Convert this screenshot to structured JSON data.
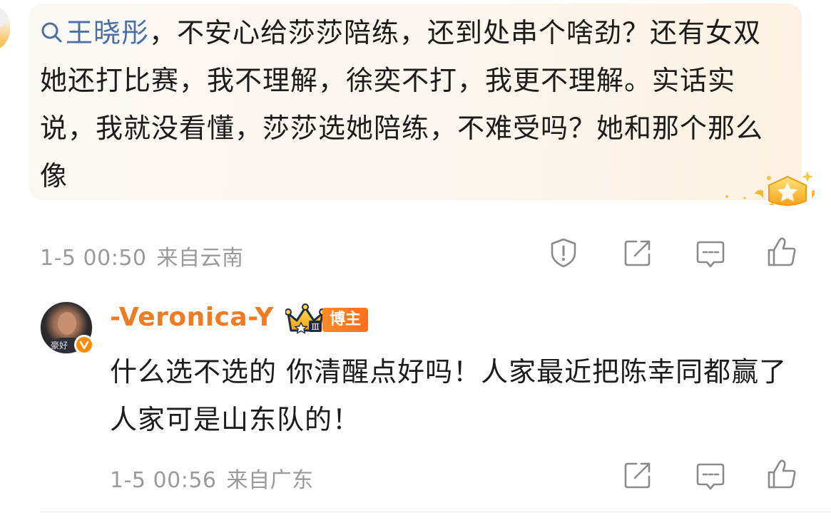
{
  "quoted_comment": {
    "mention": "王晓彤",
    "text": "，不安心给莎莎陪练，还到处串个啥劲？还有女双她还打比赛，我不理解，徐奕不打，我更不理解。实话实说，我就没看懂，莎莎选她陪练，不难受吗？她和那个那么像",
    "time": "1-5 00:50",
    "location": "来自云南"
  },
  "reply": {
    "username": "-Veronica-Y",
    "tag": "博主",
    "crown_level": "Ⅲ",
    "avatar_watermark": "豪好",
    "text": "什么选不选的 你清醒点好吗！人家最近把陈幸同都赢了 人家可是山东队的！",
    "time": "1-5 00:56",
    "location": "来自广东"
  },
  "icons": {
    "report": "shield-alert-icon",
    "share": "share-edit-icon",
    "comment": "comment-icon",
    "like": "thumbs-up-icon",
    "search": "search-icon",
    "verified": "verified-v-icon",
    "crown": "crown-icon",
    "badge": "star-badge-icon"
  },
  "colors": {
    "mention": "#4a6fa5",
    "username": "#f07b22",
    "meta": "#9a9a9a",
    "tag_bg": "#ff7a20"
  }
}
